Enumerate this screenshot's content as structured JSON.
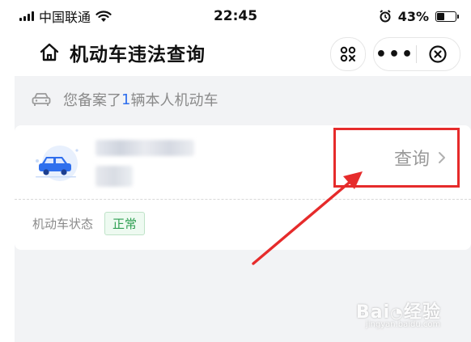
{
  "status_bar": {
    "carrier": "中国联通",
    "time": "22:45",
    "battery": "43%",
    "battery_level": 0.43,
    "icons": [
      "signal-icon",
      "wifi-icon",
      "alarm-icon",
      "battery-icon"
    ]
  },
  "nav": {
    "title": "机动车违法查询",
    "icons": [
      "home-icon",
      "scan-icon",
      "more-icon",
      "close-icon"
    ]
  },
  "notice": {
    "prefix": "您备案了",
    "count": "1",
    "suffix": "辆本人机动车"
  },
  "vehicle_card": {
    "query_label": "查询",
    "status_label": "机动车状态",
    "status_value": "正常"
  },
  "colors": {
    "accent_blue": "#2f6fed",
    "highlight_red": "#e62b2b",
    "status_green": "#2e9f52",
    "page_gray": "#f2f3f5"
  },
  "watermark": {
    "main": "Bai 经验",
    "sub": "jingyan.baidu.com"
  }
}
